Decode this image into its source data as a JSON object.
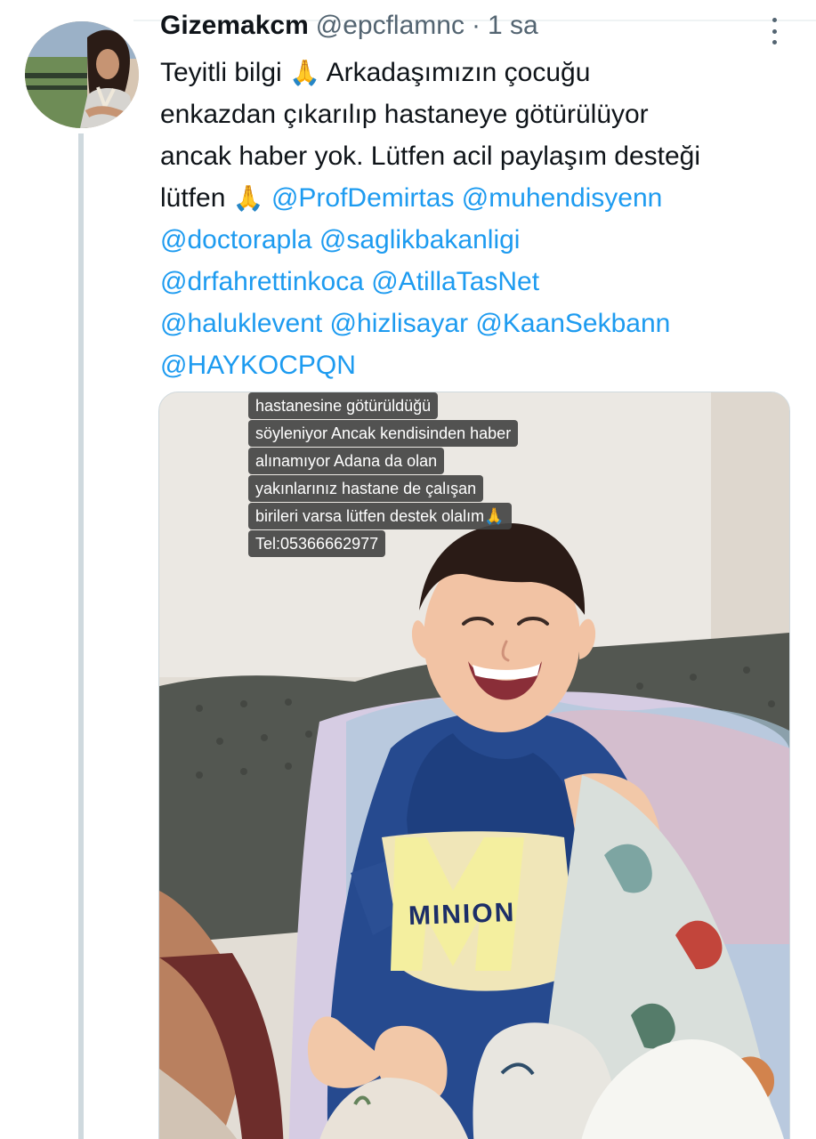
{
  "tweet": {
    "display_name": "Gizemakcm",
    "handle": "@epcflamnc",
    "dot": "·",
    "time": "1 sa",
    "text_lines": [
      {
        "text": "Teyitli bilgi ",
        "emoji": "🙏",
        "after": " Arkadaşımızın çocuğu"
      },
      {
        "text": "enkazdan çıkarılıp hastaneye götürülüyor"
      },
      {
        "text": "ancak haber yok. Lütfen acil paylaşım desteği"
      },
      {
        "text": "lütfen ",
        "emoji": "🙏",
        "mention": "@ProfDemirtas @muhendisyenn"
      },
      {
        "mention": "@doctorapla @saglikbakanligi"
      },
      {
        "mention": "@drfahrettinkoca @AtillaTasNet"
      },
      {
        "mention": "@haluklevent @hizlisayar @KaanSekbann"
      },
      {
        "mention": "@HAYKOCPQN"
      }
    ]
  },
  "media": {
    "caption_lines": [
      "hastanesine götürüldüğü",
      "söyleniyor Ancak kendisinden haber",
      "alınamıyor Adana da olan",
      "yakınlarınız hastane de çalışan",
      "birileri varsa lütfen destek olalım🙏",
      "Tel:05366662977"
    ],
    "shirt_text": "MINION"
  },
  "colors": {
    "link": "#1d9bf0",
    "text": "#0f1419",
    "muted": "#536471",
    "thread_line": "#cfd9de"
  },
  "icons": {
    "more": "more-horizontal-icon",
    "pray": "folded-hands-emoji"
  }
}
